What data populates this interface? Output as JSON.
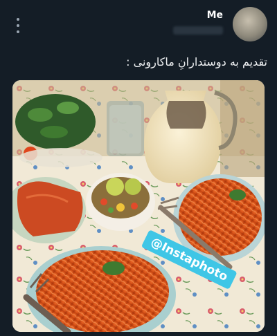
{
  "tweet": {
    "author_name": "Me",
    "text": "تقدیم به دوستدارانِ ماکارونی :"
  },
  "icons": {
    "more": "more-vertical-icon",
    "avatar": "profile-avatar"
  },
  "media": {
    "watermark": "@Instaphoto"
  },
  "colors": {
    "background": "#141d26",
    "watermark_bg": "#3fc6e6",
    "pasta": "#d9531c"
  }
}
